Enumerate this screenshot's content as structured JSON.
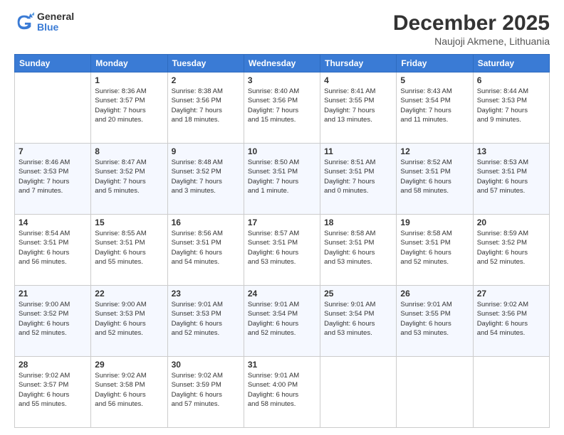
{
  "logo": {
    "general": "General",
    "blue": "Blue"
  },
  "header": {
    "month": "December 2025",
    "location": "Naujoji Akmene, Lithuania"
  },
  "weekdays": [
    "Sunday",
    "Monday",
    "Tuesday",
    "Wednesday",
    "Thursday",
    "Friday",
    "Saturday"
  ],
  "weeks": [
    [
      {
        "day": "",
        "info": ""
      },
      {
        "day": "1",
        "info": "Sunrise: 8:36 AM\nSunset: 3:57 PM\nDaylight: 7 hours\nand 20 minutes."
      },
      {
        "day": "2",
        "info": "Sunrise: 8:38 AM\nSunset: 3:56 PM\nDaylight: 7 hours\nand 18 minutes."
      },
      {
        "day": "3",
        "info": "Sunrise: 8:40 AM\nSunset: 3:56 PM\nDaylight: 7 hours\nand 15 minutes."
      },
      {
        "day": "4",
        "info": "Sunrise: 8:41 AM\nSunset: 3:55 PM\nDaylight: 7 hours\nand 13 minutes."
      },
      {
        "day": "5",
        "info": "Sunrise: 8:43 AM\nSunset: 3:54 PM\nDaylight: 7 hours\nand 11 minutes."
      },
      {
        "day": "6",
        "info": "Sunrise: 8:44 AM\nSunset: 3:53 PM\nDaylight: 7 hours\nand 9 minutes."
      }
    ],
    [
      {
        "day": "7",
        "info": "Sunrise: 8:46 AM\nSunset: 3:53 PM\nDaylight: 7 hours\nand 7 minutes."
      },
      {
        "day": "8",
        "info": "Sunrise: 8:47 AM\nSunset: 3:52 PM\nDaylight: 7 hours\nand 5 minutes."
      },
      {
        "day": "9",
        "info": "Sunrise: 8:48 AM\nSunset: 3:52 PM\nDaylight: 7 hours\nand 3 minutes."
      },
      {
        "day": "10",
        "info": "Sunrise: 8:50 AM\nSunset: 3:51 PM\nDaylight: 7 hours\nand 1 minute."
      },
      {
        "day": "11",
        "info": "Sunrise: 8:51 AM\nSunset: 3:51 PM\nDaylight: 7 hours\nand 0 minutes."
      },
      {
        "day": "12",
        "info": "Sunrise: 8:52 AM\nSunset: 3:51 PM\nDaylight: 6 hours\nand 58 minutes."
      },
      {
        "day": "13",
        "info": "Sunrise: 8:53 AM\nSunset: 3:51 PM\nDaylight: 6 hours\nand 57 minutes."
      }
    ],
    [
      {
        "day": "14",
        "info": "Sunrise: 8:54 AM\nSunset: 3:51 PM\nDaylight: 6 hours\nand 56 minutes."
      },
      {
        "day": "15",
        "info": "Sunrise: 8:55 AM\nSunset: 3:51 PM\nDaylight: 6 hours\nand 55 minutes."
      },
      {
        "day": "16",
        "info": "Sunrise: 8:56 AM\nSunset: 3:51 PM\nDaylight: 6 hours\nand 54 minutes."
      },
      {
        "day": "17",
        "info": "Sunrise: 8:57 AM\nSunset: 3:51 PM\nDaylight: 6 hours\nand 53 minutes."
      },
      {
        "day": "18",
        "info": "Sunrise: 8:58 AM\nSunset: 3:51 PM\nDaylight: 6 hours\nand 53 minutes."
      },
      {
        "day": "19",
        "info": "Sunrise: 8:58 AM\nSunset: 3:51 PM\nDaylight: 6 hours\nand 52 minutes."
      },
      {
        "day": "20",
        "info": "Sunrise: 8:59 AM\nSunset: 3:52 PM\nDaylight: 6 hours\nand 52 minutes."
      }
    ],
    [
      {
        "day": "21",
        "info": "Sunrise: 9:00 AM\nSunset: 3:52 PM\nDaylight: 6 hours\nand 52 minutes."
      },
      {
        "day": "22",
        "info": "Sunrise: 9:00 AM\nSunset: 3:53 PM\nDaylight: 6 hours\nand 52 minutes."
      },
      {
        "day": "23",
        "info": "Sunrise: 9:01 AM\nSunset: 3:53 PM\nDaylight: 6 hours\nand 52 minutes."
      },
      {
        "day": "24",
        "info": "Sunrise: 9:01 AM\nSunset: 3:54 PM\nDaylight: 6 hours\nand 52 minutes."
      },
      {
        "day": "25",
        "info": "Sunrise: 9:01 AM\nSunset: 3:54 PM\nDaylight: 6 hours\nand 53 minutes."
      },
      {
        "day": "26",
        "info": "Sunrise: 9:01 AM\nSunset: 3:55 PM\nDaylight: 6 hours\nand 53 minutes."
      },
      {
        "day": "27",
        "info": "Sunrise: 9:02 AM\nSunset: 3:56 PM\nDaylight: 6 hours\nand 54 minutes."
      }
    ],
    [
      {
        "day": "28",
        "info": "Sunrise: 9:02 AM\nSunset: 3:57 PM\nDaylight: 6 hours\nand 55 minutes."
      },
      {
        "day": "29",
        "info": "Sunrise: 9:02 AM\nSunset: 3:58 PM\nDaylight: 6 hours\nand 56 minutes."
      },
      {
        "day": "30",
        "info": "Sunrise: 9:02 AM\nSunset: 3:59 PM\nDaylight: 6 hours\nand 57 minutes."
      },
      {
        "day": "31",
        "info": "Sunrise: 9:01 AM\nSunset: 4:00 PM\nDaylight: 6 hours\nand 58 minutes."
      },
      {
        "day": "",
        "info": ""
      },
      {
        "day": "",
        "info": ""
      },
      {
        "day": "",
        "info": ""
      }
    ]
  ]
}
